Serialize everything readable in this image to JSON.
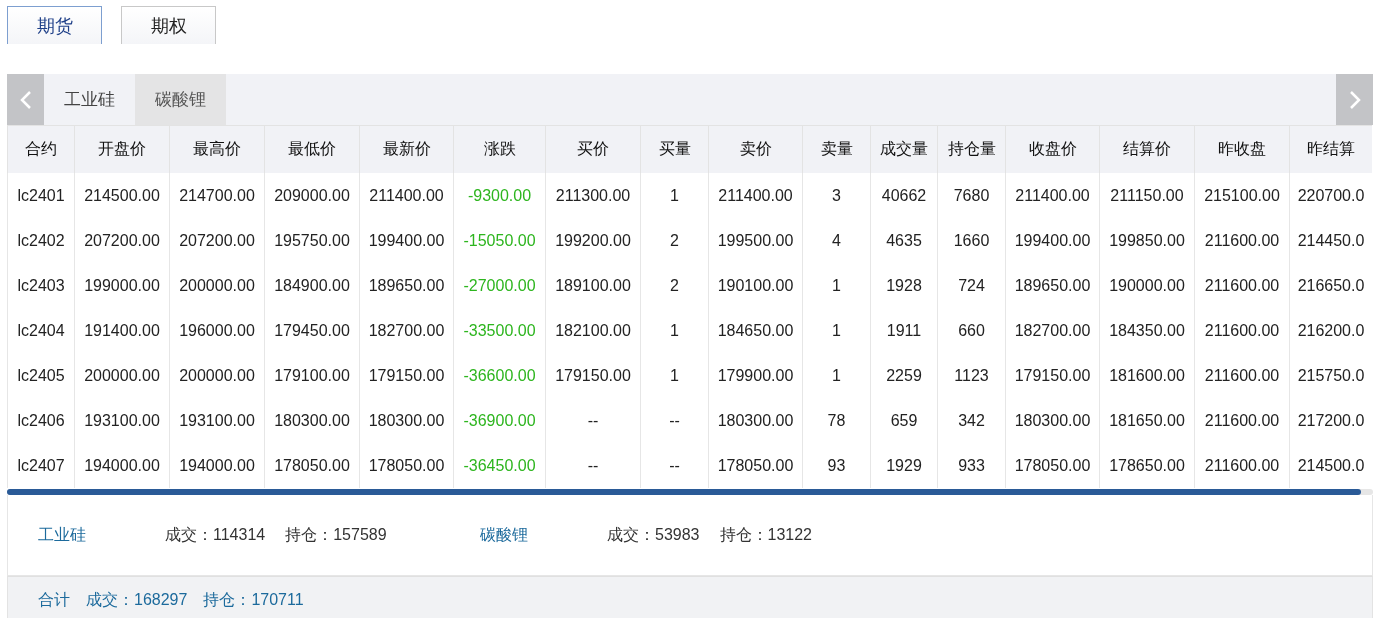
{
  "main_tabs": [
    {
      "label": "期货",
      "selected": true
    },
    {
      "label": "期权",
      "selected": false
    }
  ],
  "product_tabs": [
    {
      "label": "工业硅",
      "selected": false
    },
    {
      "label": "碳酸锂",
      "selected": true
    }
  ],
  "table": {
    "columns": [
      "合约",
      "开盘价",
      "最高价",
      "最低价",
      "最新价",
      "涨跌",
      "买价",
      "买量",
      "卖价",
      "卖量",
      "成交量",
      "持仓量",
      "收盘价",
      "结算价",
      "昨收盘",
      "昨结算"
    ],
    "rows": [
      {
        "color": "#2db51e",
        "cells": [
          "lc2401",
          "214500.00",
          "214700.00",
          "209000.00",
          "211400.00",
          "-9300.00",
          "211300.00",
          "1",
          "211400.00",
          "3",
          "40662",
          "7680",
          "211400.00",
          "211150.00",
          "215100.00",
          "220700.0"
        ]
      },
      {
        "color": "#2db51e",
        "cells": [
          "lc2402",
          "207200.00",
          "207200.00",
          "195750.00",
          "199400.00",
          "-15050.00",
          "199200.00",
          "2",
          "199500.00",
          "4",
          "4635",
          "1660",
          "199400.00",
          "199850.00",
          "211600.00",
          "214450.0"
        ]
      },
      {
        "color": "#2db51e",
        "cells": [
          "lc2403",
          "199000.00",
          "200000.00",
          "184900.00",
          "189650.00",
          "-27000.00",
          "189100.00",
          "2",
          "190100.00",
          "1",
          "1928",
          "724",
          "189650.00",
          "190000.00",
          "211600.00",
          "216650.0"
        ]
      },
      {
        "color": "#2db51e",
        "cells": [
          "lc2404",
          "191400.00",
          "196000.00",
          "179450.00",
          "182700.00",
          "-33500.00",
          "182100.00",
          "1",
          "184650.00",
          "1",
          "1911",
          "660",
          "182700.00",
          "184350.00",
          "211600.00",
          "216200.0"
        ]
      },
      {
        "color": "#2db51e",
        "cells": [
          "lc2405",
          "200000.00",
          "200000.00",
          "179100.00",
          "179150.00",
          "-36600.00",
          "179150.00",
          "1",
          "179900.00",
          "1",
          "2259",
          "1123",
          "179150.00",
          "181600.00",
          "211600.00",
          "215750.0"
        ]
      },
      {
        "color": "#2db51e",
        "cells": [
          "lc2406",
          "193100.00",
          "193100.00",
          "180300.00",
          "180300.00",
          "-36900.00",
          "--",
          "--",
          "180300.00",
          "78",
          "659",
          "342",
          "180300.00",
          "181650.00",
          "211600.00",
          "217200.0"
        ]
      },
      {
        "color": "#2db51e",
        "cells": [
          "lc2407",
          "194000.00",
          "194000.00",
          "178050.00",
          "178050.00",
          "-36450.00",
          "--",
          "--",
          "178050.00",
          "93",
          "1929",
          "933",
          "178050.00",
          "178650.00",
          "211600.00",
          "214500.0"
        ]
      }
    ]
  },
  "summary": [
    {
      "product": "工业硅",
      "volume": "成交：114314",
      "open_interest": "持仓：157589"
    },
    {
      "product": "碳酸锂",
      "volume": "成交：53983",
      "open_interest": "持仓：13122"
    }
  ],
  "total": {
    "label": "合计",
    "volume": "成交：168297",
    "open_interest": "持仓：170711"
  }
}
